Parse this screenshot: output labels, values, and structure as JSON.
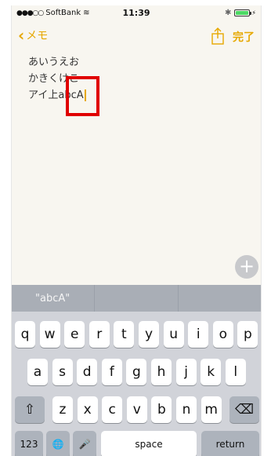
{
  "status_bar": {
    "signal": "●●●○○",
    "carrier": "SoftBank",
    "wifi": "≋",
    "time": "11:39",
    "bluetooth": "✱",
    "battery_level": 1.0
  },
  "nav": {
    "back_label": "メモ",
    "back_chevron": "‹",
    "done_label": "完了"
  },
  "note": {
    "line1": "あいうえお",
    "line2": "かきくけこ",
    "line3": "アイ上abcA"
  },
  "add_button": "+",
  "keyboard": {
    "suggestions": [
      "\"abcA\"",
      "",
      ""
    ],
    "row1": [
      "q",
      "w",
      "e",
      "r",
      "t",
      "y",
      "u",
      "i",
      "o",
      "p"
    ],
    "row2": [
      "a",
      "s",
      "d",
      "f",
      "g",
      "h",
      "j",
      "k",
      "l"
    ],
    "row3": [
      "z",
      "x",
      "c",
      "v",
      "b",
      "n",
      "m"
    ],
    "shift": "⇧",
    "delete": "⌫",
    "numbers_label": "123",
    "globe": "🌐",
    "mic": "🎤",
    "space_label": "space",
    "return_label": "return"
  },
  "colors": {
    "accent": "#e6a800",
    "highlight": "#e00000",
    "keyboard_bg": "#d1d3d9"
  }
}
